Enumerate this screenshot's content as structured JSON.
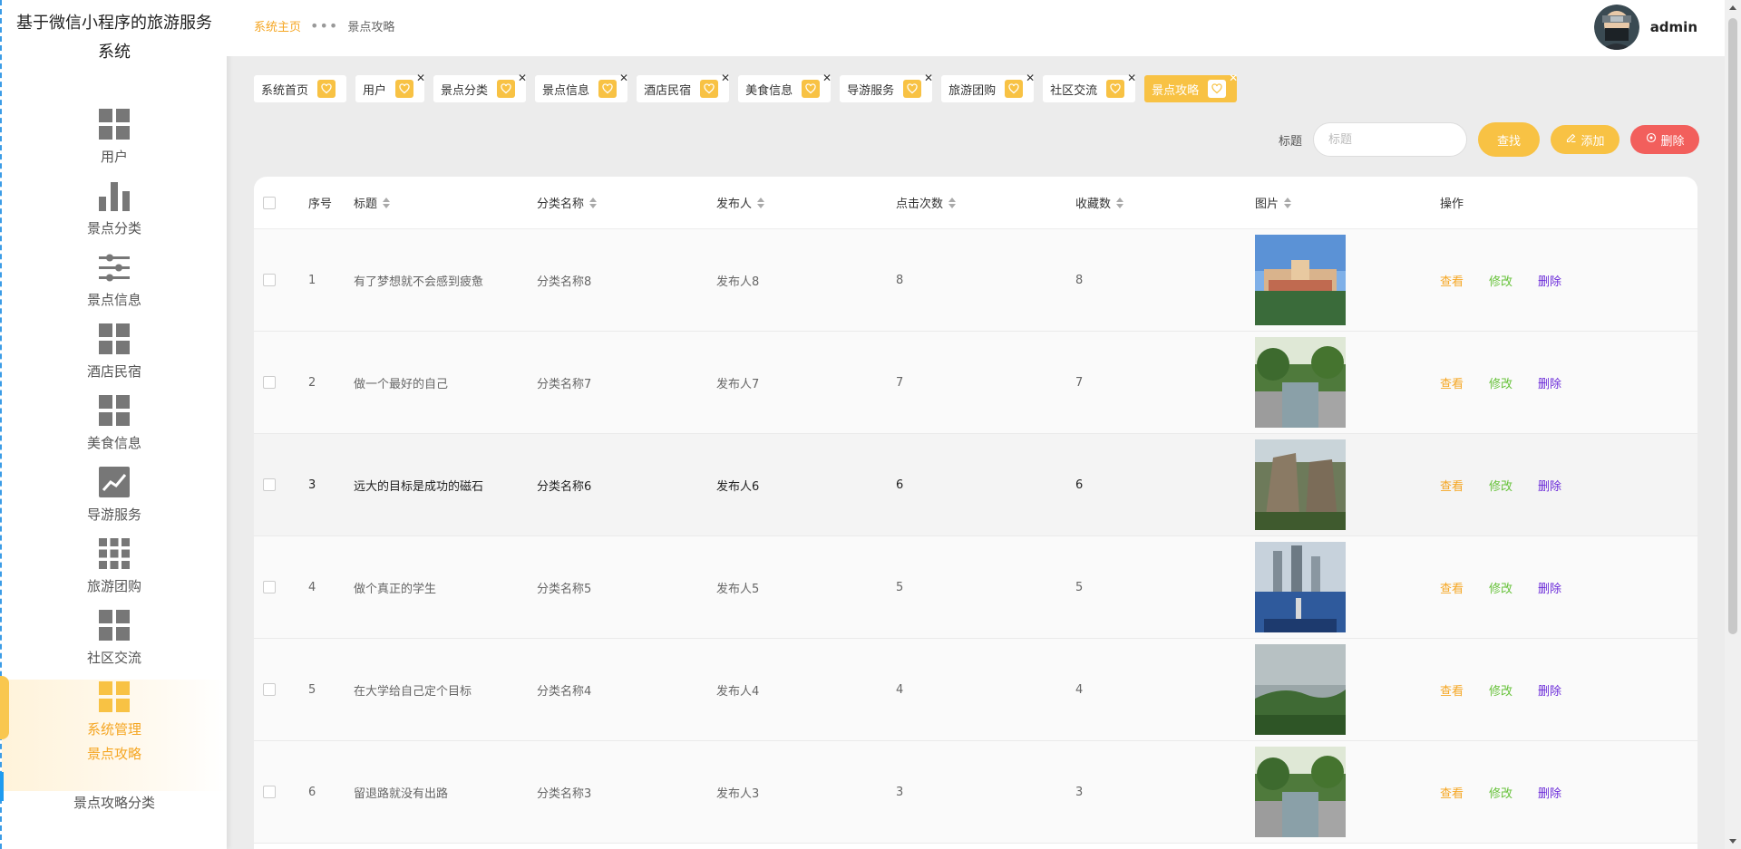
{
  "brand": {
    "title": "基于微信小程序的旅游服务系统"
  },
  "sidebar": {
    "items": [
      {
        "label": "用户",
        "icon": "grid-icon"
      },
      {
        "label": "景点分类",
        "icon": "bar-chart-icon"
      },
      {
        "label": "景点信息",
        "icon": "sliders-icon"
      },
      {
        "label": "酒店民宿",
        "icon": "grid-icon"
      },
      {
        "label": "美食信息",
        "icon": "grid-icon"
      },
      {
        "label": "导游服务",
        "icon": "trend-chart-icon"
      },
      {
        "label": "旅游团购",
        "icon": "apps-grid-icon"
      },
      {
        "label": "社区交流",
        "icon": "grid-icon"
      },
      {
        "label": "系统管理",
        "icon": "grid-icon"
      }
    ],
    "active_sub": "景点攻略",
    "sub_item": "景点攻略分类"
  },
  "breadcrumb": {
    "home": "系统主页",
    "sep": "•••",
    "current": "景点攻略"
  },
  "user": {
    "name": "admin"
  },
  "tags": [
    {
      "label": "系统首页"
    },
    {
      "label": "用户"
    },
    {
      "label": "景点分类"
    },
    {
      "label": "景点信息"
    },
    {
      "label": "酒店民宿"
    },
    {
      "label": "美食信息"
    },
    {
      "label": "导游服务"
    },
    {
      "label": "旅游团购"
    },
    {
      "label": "社区交流"
    },
    {
      "label": "景点攻略"
    }
  ],
  "search": {
    "label": "标题",
    "placeholder": "标题",
    "value": "",
    "find": "查找",
    "add": "添加",
    "delete": "删除"
  },
  "table": {
    "headers": {
      "idx": "序号",
      "title": "标题",
      "category": "分类名称",
      "publisher": "发布人",
      "clicks": "点击次数",
      "favorites": "收藏数",
      "image": "图片",
      "ops": "操作"
    },
    "ops": {
      "view": "查看",
      "edit": "修改",
      "delete": "删除"
    },
    "rows": [
      {
        "idx": "1",
        "title": "有了梦想就不会感到疲惫",
        "category": "分类名称8",
        "publisher": "发布人8",
        "clicks": "8",
        "favorites": "8",
        "scene": "city"
      },
      {
        "idx": "2",
        "title": "做一个最好的自己",
        "category": "分类名称7",
        "publisher": "发布人7",
        "clicks": "7",
        "favorites": "7",
        "scene": "canal"
      },
      {
        "idx": "3",
        "title": "远大的目标是成功的磁石",
        "category": "分类名称6",
        "publisher": "发布人6",
        "clicks": "6",
        "favorites": "6",
        "scene": "cliff"
      },
      {
        "idx": "4",
        "title": "做个真正的学生",
        "category": "分类名称5",
        "publisher": "发布人5",
        "clicks": "5",
        "favorites": "5",
        "scene": "towers"
      },
      {
        "idx": "5",
        "title": "在大学给自己定个目标",
        "category": "分类名称4",
        "publisher": "发布人4",
        "clicks": "4",
        "favorites": "4",
        "scene": "hills"
      },
      {
        "idx": "6",
        "title": "留退路就没有出路",
        "category": "分类名称3",
        "publisher": "发布人3",
        "clicks": "3",
        "favorites": "3",
        "scene": "canal"
      }
    ]
  },
  "colors": {
    "accent": "#f8c244",
    "danger": "#f25f5c",
    "edit": "#67c23a",
    "delete_link": "#6b2bd9"
  }
}
